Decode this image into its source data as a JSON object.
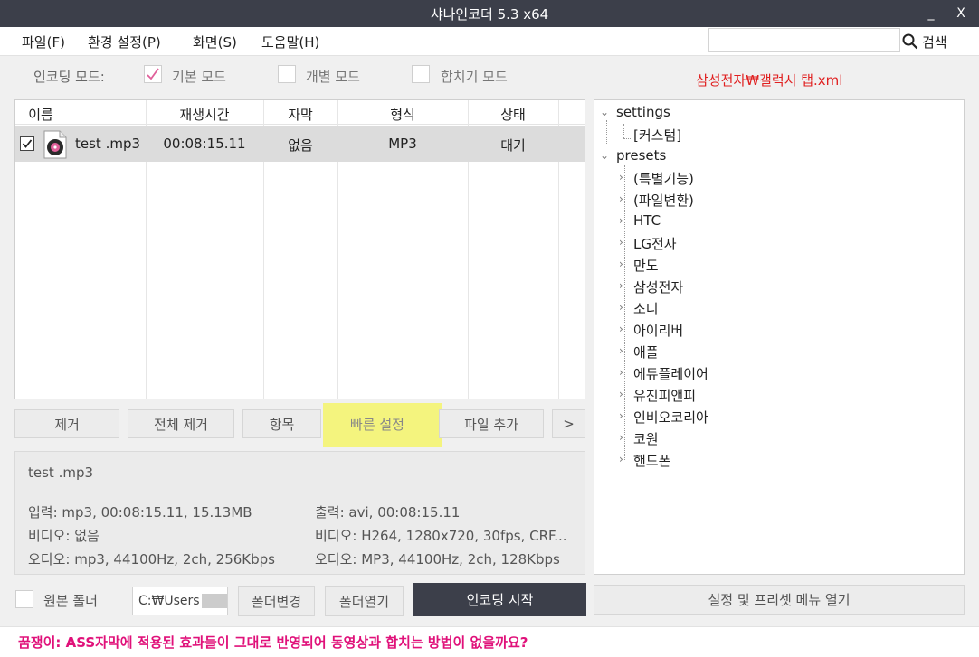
{
  "window": {
    "title": "샤나인코더  5.3  x64",
    "minimize_glyph": "_",
    "close_glyph": "X"
  },
  "menu": {
    "items": [
      "파일(F)",
      "환경 설정(P)",
      "화면(S)",
      "도움말(H)"
    ],
    "search_placeholder": "",
    "search_label": "검색"
  },
  "mode": {
    "label": "인코딩 모드:",
    "options": [
      {
        "label": "기본 모드",
        "checked": true
      },
      {
        "label": "개별 모드",
        "checked": false
      },
      {
        "label": "합치기 모드",
        "checked": false
      }
    ],
    "preset_path": "삼성전자₩갤럭시 탭.xml"
  },
  "filelist": {
    "columns": [
      "이름",
      "재생시간",
      "자막",
      "형식",
      "상태"
    ],
    "rows": [
      {
        "checked": true,
        "name": "test .mp3",
        "duration": "00:08:15.11",
        "subtitle": "없음",
        "format": "MP3",
        "status": "대기"
      }
    ]
  },
  "buttons": {
    "remove": "제거",
    "remove_all": "전체 제거",
    "items": "항목",
    "quick_settings": "빠른 설정",
    "add_file": "파일 추가",
    "more": ">"
  },
  "info": {
    "filename": "test .mp3",
    "input": "입력: mp3, 00:08:15.11, 15.13MB",
    "output": "출력: avi, 00:08:15.11",
    "video_in": "비디오: 없음",
    "video_out": "비디오: H264, 1280x720, 30fps, CRF...",
    "audio_in": "오디오: mp3, 44100Hz, 2ch, 256Kbps",
    "audio_out": "오디오: MP3, 44100Hz, 2ch, 128Kbps"
  },
  "tree": {
    "settings": {
      "label": "settings",
      "children": [
        "[커스텀]"
      ]
    },
    "presets": {
      "label": "presets",
      "children": [
        "(특별기능)",
        "(파일변환)",
        "HTC",
        "LG전자",
        "만도",
        "삼성전자",
        "소니",
        "아이리버",
        "애플",
        "에듀플레이어",
        "유진피앤피",
        "인비오코리아",
        "코원",
        "핸드폰"
      ]
    }
  },
  "bottom": {
    "source_folder_label": "원본 폴더",
    "folder_path": "C:₩Users",
    "change_folder": "폴더변경",
    "open_folder": "폴더열기",
    "start_encoding": "인코딩 시작",
    "settings_menu": "설정 및 프리셋 메뉴 열기"
  },
  "tip": "꿈쟁이: ASS자막에 적용된 효과들이 그대로 반영되어 동영상과 합치는 방법이 없을까요?",
  "colors": {
    "titlebar": "#3c3f4a",
    "preset_path": "#e02020",
    "tip": "#e0117a",
    "highlight": "#f5f56a"
  }
}
